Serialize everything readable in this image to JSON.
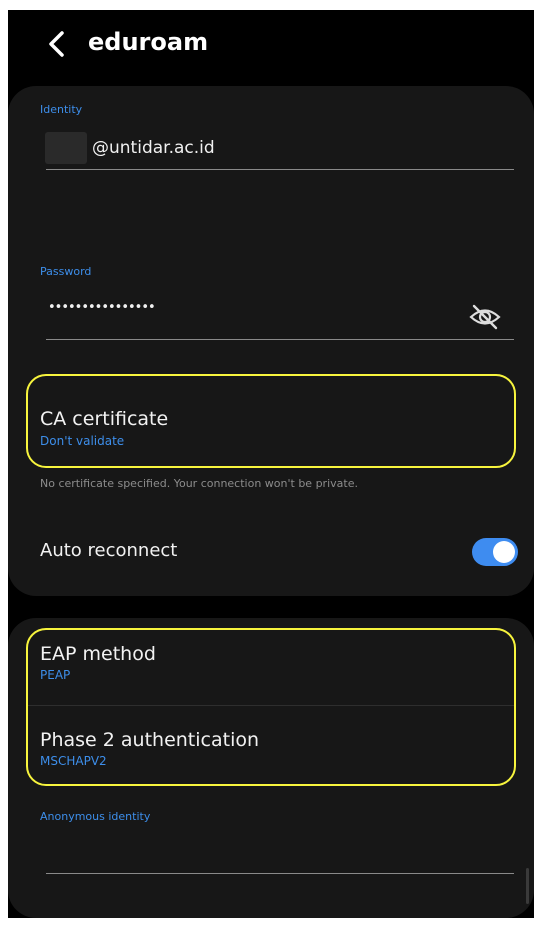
{
  "header": {
    "title": "eduroam",
    "back_icon": "chevron-left-icon"
  },
  "identity": {
    "label": "Identity",
    "value": "@untidar.ac.id"
  },
  "password": {
    "label": "Password",
    "value": "••••••••••••••••",
    "visibility_icon": "eye-off-icon"
  },
  "ca_certificate": {
    "title": "CA certificate",
    "value": "Don't validate",
    "hint": "No certificate specified. Your connection won't be private."
  },
  "auto_reconnect": {
    "label": "Auto reconnect",
    "enabled": true
  },
  "eap_method": {
    "title": "EAP method",
    "value": "PEAP"
  },
  "phase2": {
    "title": "Phase 2 authentication",
    "value": "MSCHAPV2"
  },
  "anonymous_identity": {
    "label": "Anonymous identity",
    "value": ""
  },
  "colors": {
    "accent": "#3d8eea",
    "highlight": "#f7f43d",
    "background": "#000000",
    "card": "#171717"
  }
}
